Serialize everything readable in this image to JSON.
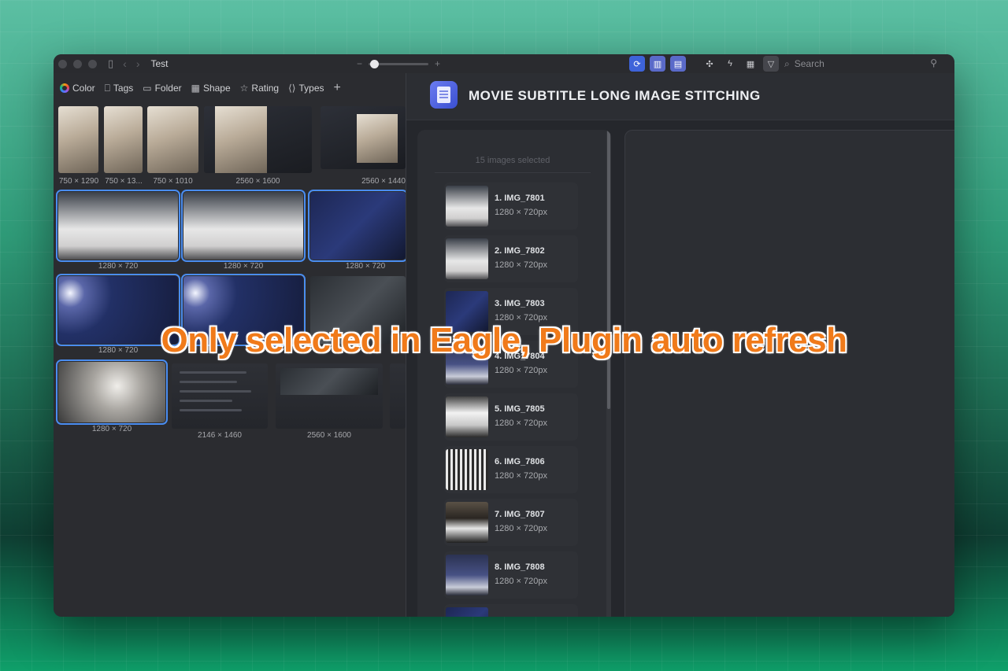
{
  "window": {
    "title": "Test",
    "search_placeholder": "Search"
  },
  "filters": [
    {
      "label": "Color",
      "icon": "color-wheel-icon"
    },
    {
      "label": "Tags",
      "icon": "bookmark-icon"
    },
    {
      "label": "Folder",
      "icon": "folder-icon"
    },
    {
      "label": "Shape",
      "icon": "shape-icon"
    },
    {
      "label": "Rating",
      "icon": "star-icon"
    },
    {
      "label": "Types",
      "icon": "code-icon"
    }
  ],
  "grid": {
    "captions": [
      "750 × 1290",
      "750 × 13...",
      "750 × 1010",
      "2560 × 1600",
      "2560 × 1440",
      "1280 × 720",
      "1280 × 720",
      "1280 × 720",
      "1280 × 720",
      "1280 × 720",
      "2146 × 1460",
      "2560 × 1600"
    ]
  },
  "plugin": {
    "title": "MOVIE SUBTITLE LONG IMAGE STITCHING",
    "selected_count": "15 images selected",
    "items": [
      {
        "name": "1. IMG_7801",
        "size": "1280 × 720px"
      },
      {
        "name": "2. IMG_7802",
        "size": "1280 × 720px"
      },
      {
        "name": "3. IMG_7803",
        "size": "1280 × 720px"
      },
      {
        "name": "4. IMG_7804",
        "size": "1280 × 720px"
      },
      {
        "name": "5. IMG_7805",
        "size": "1280 × 720px"
      },
      {
        "name": "6. IMG_7806",
        "size": "1280 × 720px"
      },
      {
        "name": "7. IMG_7807",
        "size": "1280 × 720px"
      },
      {
        "name": "8. IMG_7808",
        "size": "1280 × 720px"
      }
    ]
  },
  "overlay_text": "Only selected in Eagle, Plugin auto refresh"
}
